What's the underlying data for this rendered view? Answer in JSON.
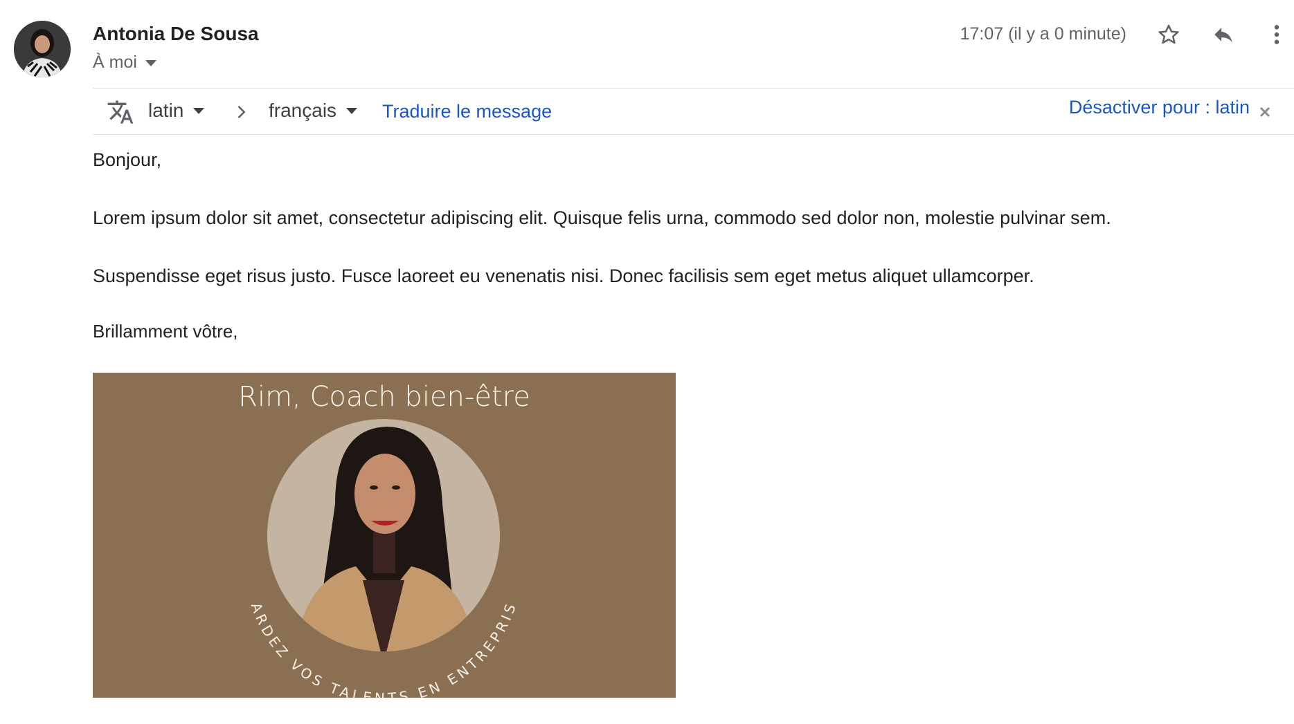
{
  "header": {
    "sender_name": "Antonia De Sousa",
    "recipient_label": "À moi",
    "timestamp": "17:07 (il y a 0 minute)",
    "icons": [
      "star-icon",
      "reply-icon",
      "more-vert-icon"
    ]
  },
  "translate_bar": {
    "source_language": "latin",
    "target_language": "français",
    "translate_label": "Traduire le message",
    "disable_label": "Désactiver pour : latin",
    "icons": [
      "translate-icon",
      "chevron-right-icon",
      "close-icon"
    ]
  },
  "message": {
    "greeting": "Bonjour,",
    "paragraph1": "Lorem ipsum dolor sit amet, consectetur adipiscing elit. Quisque felis urna, commodo sed dolor non, molestie pulvinar sem.",
    "paragraph2": "Suspendisse eget risus justo. Fusce laoreet eu venenatis nisi. Donec facilisis sem eget metus aliquet ullamcorper.",
    "closing": "Brillamment vôtre,"
  },
  "signature": {
    "title": "Rim, Coach bien-être",
    "tagline": "GARDEZ VOS TALENTS EN ENTREPRISE",
    "background_color": "#8a6f52"
  },
  "colors": {
    "link": "#1a56c8",
    "text": "#202124",
    "muted": "#5f6368"
  }
}
